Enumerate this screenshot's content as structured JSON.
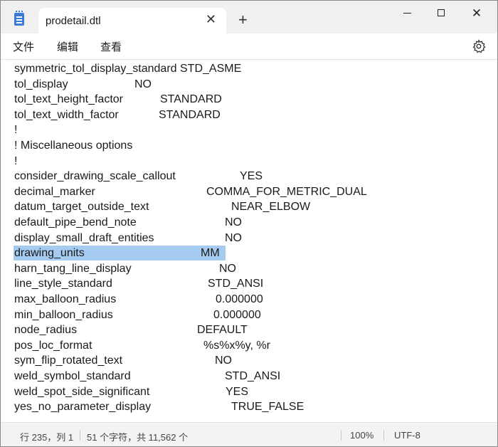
{
  "window": {
    "tab_title": "prodetail.dtl",
    "tab_close": "✕",
    "new_tab": "+",
    "controls": {
      "close": "✕"
    }
  },
  "menu": {
    "file": "文件",
    "edit": "编辑",
    "view": "查看",
    "settings_icon": "gear-icon"
  },
  "editor": {
    "selected_line": "drawing_units",
    "selection_color": "#a6cbf0",
    "lines": [
      {
        "key": "symmetric_tol_display_standard STD_ASME",
        "value": ""
      },
      {
        "key": "tol_display",
        "value": "NO"
      },
      {
        "key": "tol_text_height_factor",
        "value": "STANDARD"
      },
      {
        "key": "tol_text_width_factor",
        "value": "STANDARD"
      },
      {
        "key": "!",
        "value": ""
      },
      {
        "key": "! Miscellaneous options",
        "value": ""
      },
      {
        "key": "!",
        "value": ""
      },
      {
        "key": "consider_drawing_scale_callout",
        "value": "YES"
      },
      {
        "key": "decimal_marker",
        "value": "COMMA_FOR_METRIC_DUAL"
      },
      {
        "key": "datum_target_outside_text",
        "value": "NEAR_ELBOW"
      },
      {
        "key": "default_pipe_bend_note",
        "value": "NO"
      },
      {
        "key": "display_small_draft_entities",
        "value": "NO"
      },
      {
        "key": "drawing_units",
        "value": "MM"
      },
      {
        "key": "harn_tang_line_display",
        "value": "NO"
      },
      {
        "key": "line_style_standard",
        "value": "STD_ANSI"
      },
      {
        "key": "max_balloon_radius",
        "value": "0.000000"
      },
      {
        "key": "min_balloon_radius",
        "value": "0.000000"
      },
      {
        "key": "node_radius",
        "value": "DEFAULT"
      },
      {
        "key": "pos_loc_format",
        "value": "%s%x%y, %r"
      },
      {
        "key": "sym_flip_rotated_text",
        "value": "NO"
      },
      {
        "key": "weld_symbol_standard",
        "value": "STD_ANSI"
      },
      {
        "key": "weld_spot_side_significant",
        "value": "YES"
      },
      {
        "key": "yes_no_parameter_display",
        "value": "TRUE_FALSE"
      }
    ]
  },
  "status": {
    "position": "行 235，列 1",
    "chars": "51 个字符，共 11,562 个",
    "zoom": "100%",
    "encoding": "UTF-8"
  }
}
